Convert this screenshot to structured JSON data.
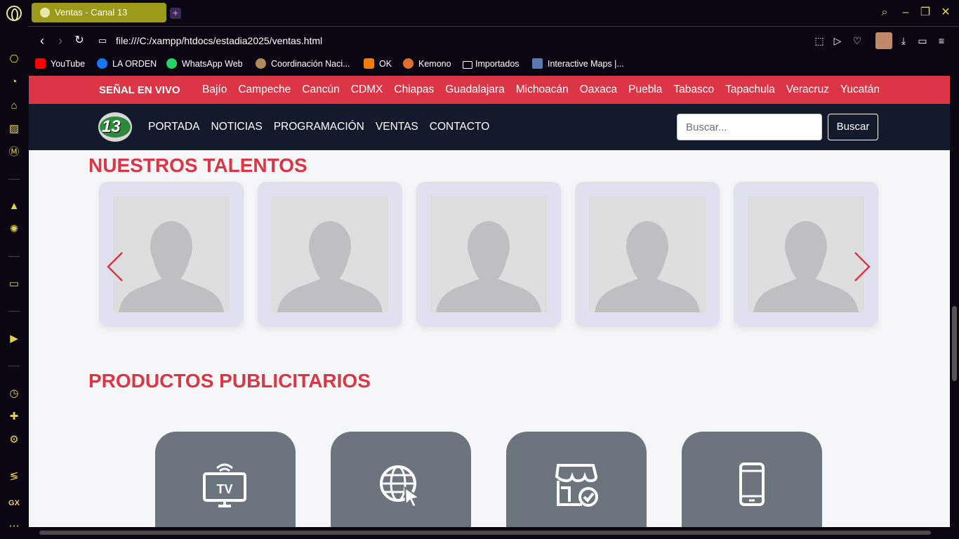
{
  "tab": {
    "title": "Ventas - Canal 13"
  },
  "address": {
    "url": "file:///C:/xampp/htdocs/estadia2025/ventas.html"
  },
  "bookmarks": [
    {
      "label": "YouTube",
      "icon": "youtube-icon",
      "color": "#ff0000"
    },
    {
      "label": "LA ORDEN",
      "icon": "facebook-icon",
      "color": "#1877f2"
    },
    {
      "label": "WhatsApp Web",
      "icon": "whatsapp-icon",
      "color": "#25d366"
    },
    {
      "label": "Coordinación Naci...",
      "icon": "globe-icon",
      "color": "#b08a5a"
    },
    {
      "label": "OK",
      "icon": "ok-icon",
      "color": "#f27b0a"
    },
    {
      "label": "Kemono",
      "icon": "kemono-icon",
      "color": "#e07030"
    },
    {
      "label": "Importados",
      "icon": "folder-icon",
      "color": "#ffffff"
    },
    {
      "label": "Interactive Maps |...",
      "icon": "map-icon",
      "color": "#5a7ab0"
    }
  ],
  "topbar": {
    "live_label": "SEÑAL EN VIVO",
    "cities": [
      "Bajío",
      "Campeche",
      "Cancún",
      "CDMX",
      "Chiapas",
      "Guadalajara",
      "Michoacán",
      "Oaxaca",
      "Puebla",
      "Tabasco",
      "Tapachula",
      "Veracruz",
      "Yucatán"
    ]
  },
  "navbar": {
    "logo_text": "13",
    "menu": [
      "PORTADA",
      "NOTICIAS",
      "PROGRAMACIÓN",
      "VENTAS",
      "CONTACTO"
    ],
    "search_placeholder": "Buscar...",
    "search_button": "Buscar"
  },
  "talents": {
    "title": "NUESTROS TALENTOS",
    "count": 5
  },
  "products": {
    "title": "PRODUCTOS PUBLICITARIOS",
    "items": [
      {
        "icon": "tv-icon"
      },
      {
        "icon": "web-icon"
      },
      {
        "icon": "store-icon"
      },
      {
        "icon": "mobile-icon"
      }
    ]
  },
  "colors": {
    "accent": "#dc3545",
    "navbar": "#121a2b",
    "card": "#dfe1ee",
    "product": "#6c757d",
    "browser_accent": "#e6d24a"
  }
}
